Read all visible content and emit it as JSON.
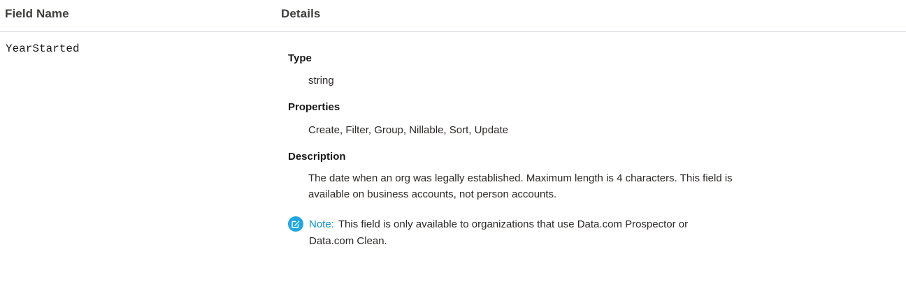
{
  "table": {
    "headers": {
      "field_name": "Field Name",
      "details": "Details"
    },
    "row": {
      "field_name": "YearStarted",
      "type_label": "Type",
      "type_value": "string",
      "properties_label": "Properties",
      "properties_value": "Create, Filter, Group, Nillable, Sort, Update",
      "description_label": "Description",
      "description_line1": "The date when an org was legally established. Maximum length is 4 characters. This field is",
      "description_line2": "available on business accounts, not person accounts.",
      "note": {
        "icon": "note-edit-icon",
        "label": "Note:",
        "text": "This field is only available to organizations that use Data.com Prospector or Data.com Clean."
      }
    }
  },
  "colors": {
    "note_icon_bg": "#1fa7e1",
    "note_label": "#0c8fd0",
    "divider": "#d8dde6"
  }
}
